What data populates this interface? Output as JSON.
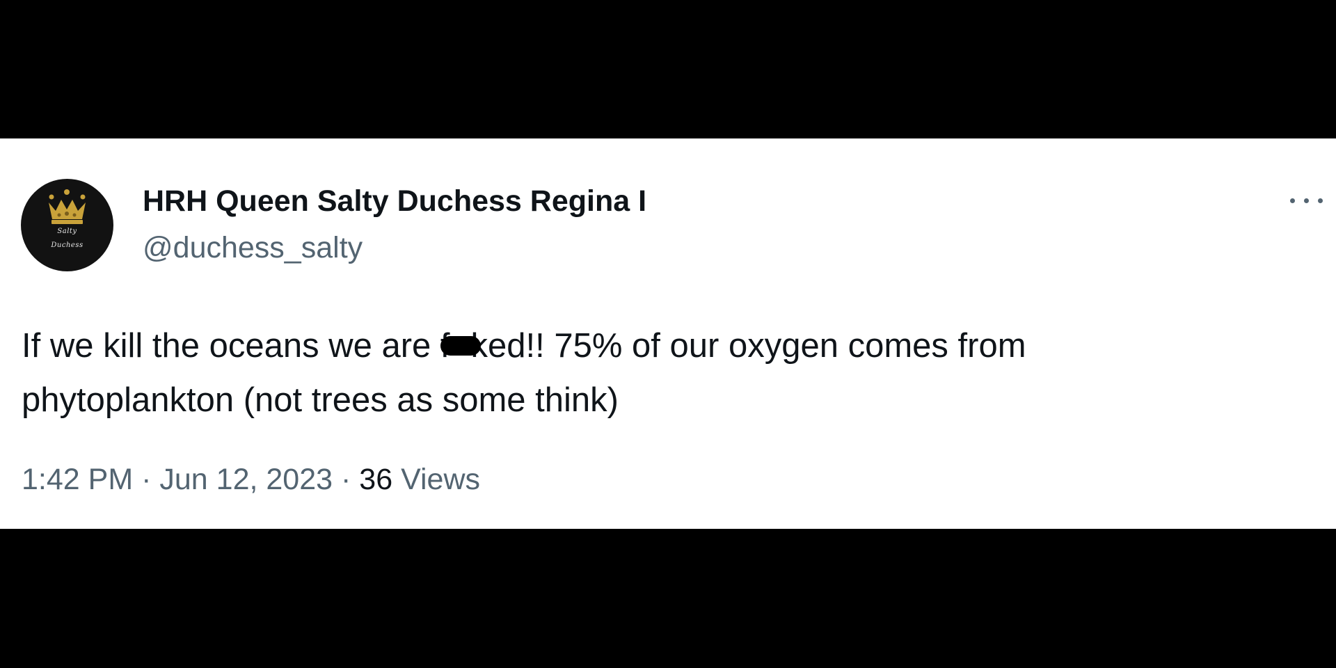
{
  "tweet": {
    "author": {
      "display_name": "HRH Queen Salty Duchess Regina I",
      "handle": "@duchess_salty",
      "avatar_text_line1": "Salty",
      "avatar_text_line2": "Duchess",
      "avatar_icon": "crown-icon"
    },
    "text": {
      "line1_before": "If we kill the oceans we are f",
      "line1_after": "ked!!  75% of our oxygen comes from",
      "line2": "phytoplankton (not trees as some think)"
    },
    "time": "1:42 PM",
    "separator": "·",
    "date": "Jun 12, 2023",
    "views_count": "36",
    "views_label": "Views",
    "more_icon": "more-options-icon"
  },
  "colors": {
    "background_outer": "#000000",
    "card": "#ffffff",
    "primary_text": "#0f1419",
    "secondary_text": "#536471",
    "avatar_bg": "#121212",
    "crown_gold": "#c9a23a"
  }
}
